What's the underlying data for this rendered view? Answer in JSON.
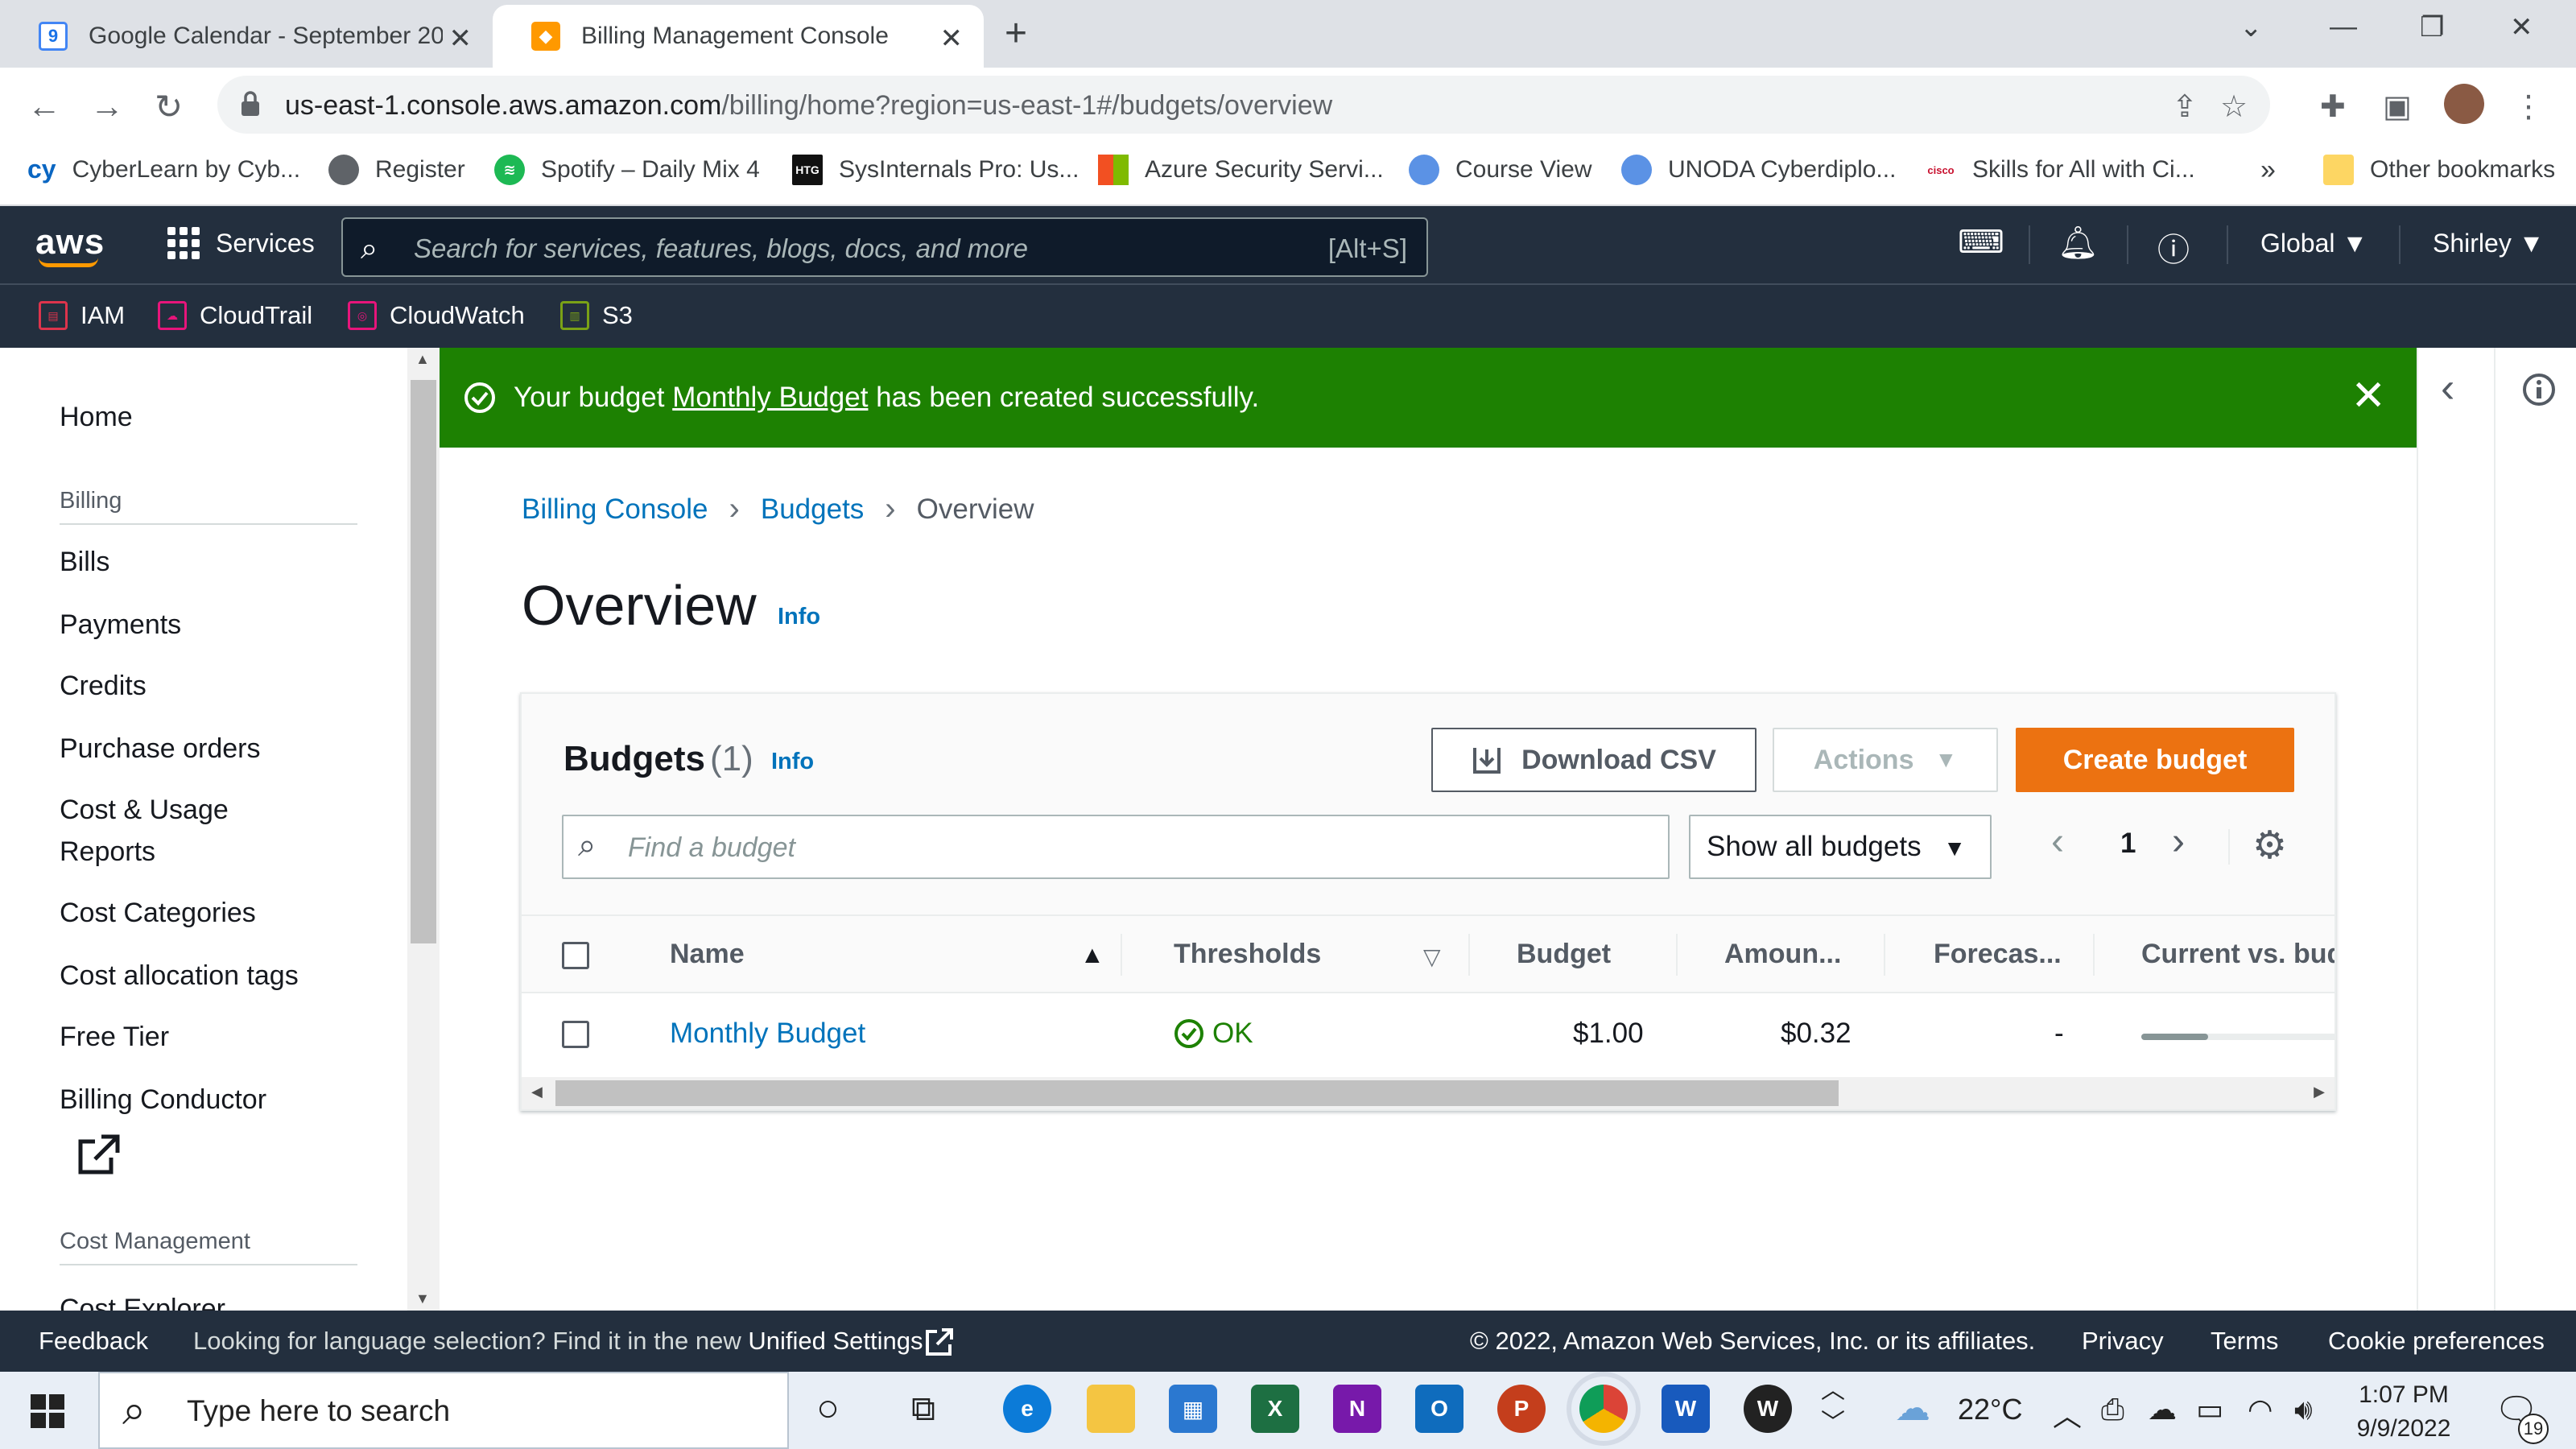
{
  "browser": {
    "tabs": [
      {
        "title": "Google Calendar - September 20…",
        "icon": "calendar-icon",
        "icon_text": "9"
      },
      {
        "title": "Billing Management Console",
        "icon": "aws-box-icon"
      }
    ],
    "url_host": "us-east-1.console.aws.amazon.com",
    "url_path": "/billing/home?region=us-east-1#/budgets/overview",
    "bookmarks": [
      {
        "label": "CyberLearn by Cyb...",
        "icon_text": "cy",
        "color": "#0a66c2"
      },
      {
        "label": "Register",
        "icon_text": "",
        "color": "#5f6368"
      },
      {
        "label": "Spotify – Daily Mix 4",
        "icon_text": "",
        "color": "#1db954"
      },
      {
        "label": "SysInternals Pro: Us...",
        "icon_text": "HTG",
        "color": "#111111"
      },
      {
        "label": "Azure Security Servi...",
        "icon_text": "",
        "color": "#f25022"
      },
      {
        "label": "Course View",
        "icon_text": "",
        "color": "#5b92e5"
      },
      {
        "label": "UNODA Cyberdiplo...",
        "icon_text": "",
        "color": "#5b92e5"
      },
      {
        "label": "Skills for All with Ci...",
        "icon_text": "cisco",
        "color": "#c8102e"
      }
    ],
    "more_bookmarks": "»",
    "other_bookmarks": "Other bookmarks"
  },
  "aws_header": {
    "logo": "aws",
    "services": "Services",
    "search_placeholder": "Search for services, features, blogs, docs, and more",
    "search_shortcut": "[Alt+S]",
    "region": "Global",
    "user": "Shirley",
    "favorites": [
      {
        "label": "IAM",
        "color": "#dd344c"
      },
      {
        "label": "CloudTrail",
        "color": "#e7157b"
      },
      {
        "label": "CloudWatch",
        "color": "#e7157b"
      },
      {
        "label": "S3",
        "color": "#7aa116"
      }
    ]
  },
  "sidenav": {
    "home": "Home",
    "billing_section": "Billing",
    "billing_items": [
      "Bills",
      "Payments",
      "Credits",
      "Purchase orders"
    ],
    "cost_usage_1": "Cost & Usage",
    "cost_usage_2": "Reports",
    "more_items": [
      "Cost Categories",
      "Cost allocation tags",
      "Free Tier"
    ],
    "billing_conductor": "Billing Conductor",
    "cost_mgmt_section": "Cost Management",
    "cost_explorer": "Cost Explorer"
  },
  "flash": {
    "prefix": "Your budget ",
    "link": "Monthly Budget",
    "suffix": " has been created successfully."
  },
  "breadcrumb": {
    "items": [
      "Billing Console",
      "Budgets"
    ],
    "current": "Overview"
  },
  "page": {
    "title": "Overview",
    "info": "Info"
  },
  "budgets": {
    "title": "Budgets",
    "count": "(1)",
    "info": "Info",
    "download_csv": "Download CSV",
    "actions": "Actions",
    "create": "Create budget",
    "search_placeholder": "Find a budget",
    "filter_value": "Show all budgets",
    "page_number": "1",
    "columns": [
      "Name",
      "Thresholds",
      "Budget",
      "Amoun...",
      "Forecas...",
      "Current vs. bud"
    ],
    "rows": [
      {
        "name": "Monthly Budget",
        "threshold": "OK",
        "budget": "$1.00",
        "amount": "$0.32",
        "forecast": "-",
        "current_vs_budget_fraction": 0.32
      }
    ]
  },
  "footer": {
    "feedback": "Feedback",
    "lang_prefix": "Looking for language selection? Find it in the new ",
    "lang_link": "Unified Settings",
    "copyright": "© 2022, Amazon Web Services, Inc. or its affiliates.",
    "privacy": "Privacy",
    "terms": "Terms",
    "cookies": "Cookie preferences"
  },
  "taskbar": {
    "search_placeholder": "Type here to search",
    "temperature": "22°C",
    "time": "1:07 PM",
    "date": "9/9/2022",
    "notification_count": "19"
  },
  "colors": {
    "aws_nav": "#232f3e",
    "success": "#1d8102",
    "primary_button": "#ec7211",
    "link": "#0073bb"
  }
}
